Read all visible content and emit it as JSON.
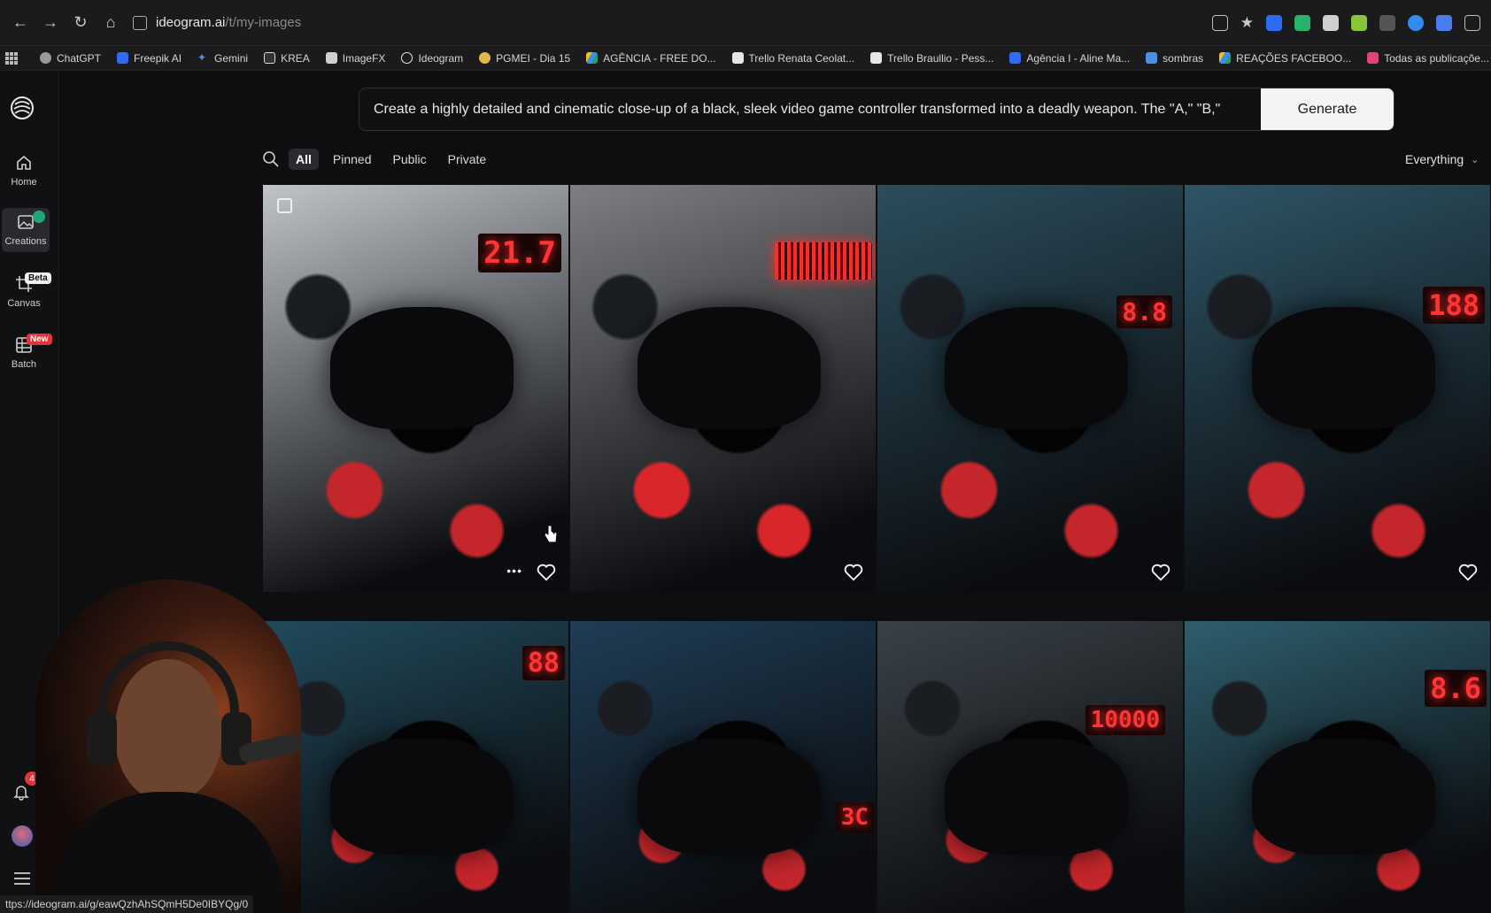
{
  "browser": {
    "url_host": "ideogram.ai",
    "url_path": "/t/my-images",
    "status_url": "ttps://ideogram.ai/g/eawQzhAhSQmH5De0IBYQg/0"
  },
  "bookmarks": [
    {
      "label": "ChatGPT",
      "color": "#9a9a9a"
    },
    {
      "label": "Freepik AI",
      "color": "#2f6cf6"
    },
    {
      "label": "Gemini",
      "color": "#5b8cf0"
    },
    {
      "label": "KREA",
      "color": "#dddddd"
    },
    {
      "label": "ImageFX",
      "color": "#cfcfcf"
    },
    {
      "label": "Ideogram",
      "color": "#e6e6e6"
    },
    {
      "label": "PGMEI - Dia 15",
      "color": "#e0b84a"
    },
    {
      "label": "AGÊNCIA - FREE DO...",
      "color": "#3c8df0"
    },
    {
      "label": "Trello Renata Ceolat...",
      "color": "#e6e6e6"
    },
    {
      "label": "Trello Braullio - Pess...",
      "color": "#e6e6e6"
    },
    {
      "label": "Agência I - Aline Ma...",
      "color": "#2f6cf6"
    },
    {
      "label": "sombras",
      "color": "#4a90e2"
    },
    {
      "label": "REAÇÕES FACEBOO...",
      "color": "#3c8df0"
    },
    {
      "label": "Todas as publicaçõe...",
      "color": "#e0457a"
    }
  ],
  "sidebar": {
    "home": "Home",
    "creations": "Creations",
    "canvas": "Canvas",
    "canvas_badge": "Beta",
    "batch": "Batch",
    "batch_badge": "New",
    "notifications_count": "4"
  },
  "prompt": {
    "text": "Create a highly detailed and cinematic close-up of a black, sleek video game controller transformed into a deadly weapon. The \"A,\" \"B,\"",
    "generate_label": "Generate"
  },
  "filters": {
    "items": [
      "All",
      "Pinned",
      "Public",
      "Private"
    ],
    "active": "All",
    "sort_label": "Everything"
  },
  "images": [
    {
      "readout": "21.7",
      "accent": "#c3262b",
      "tone": "#bfc4c9"
    },
    {
      "readout": "",
      "accent": "#d8262b",
      "tone": "#7d7f83"
    },
    {
      "readout": "8.8",
      "accent": "#c3262b",
      "tone": "#2b4d5c"
    },
    {
      "readout": "188",
      "accent": "#c3262b",
      "tone": "#2e5566"
    },
    {
      "readout": "88",
      "accent": "#c3262b",
      "tone": "#214a5b"
    },
    {
      "readout": "3C",
      "accent": "#c3262b",
      "tone": "#1f3d55"
    },
    {
      "readout": "10000",
      "accent": "#c3262b",
      "tone": "#3a4247"
    },
    {
      "readout": "8.6",
      "accent": "#c3262b",
      "tone": "#2e5e6d"
    }
  ],
  "colors": {
    "accent_green": "#21a67a",
    "badge_red": "#e0363b"
  }
}
